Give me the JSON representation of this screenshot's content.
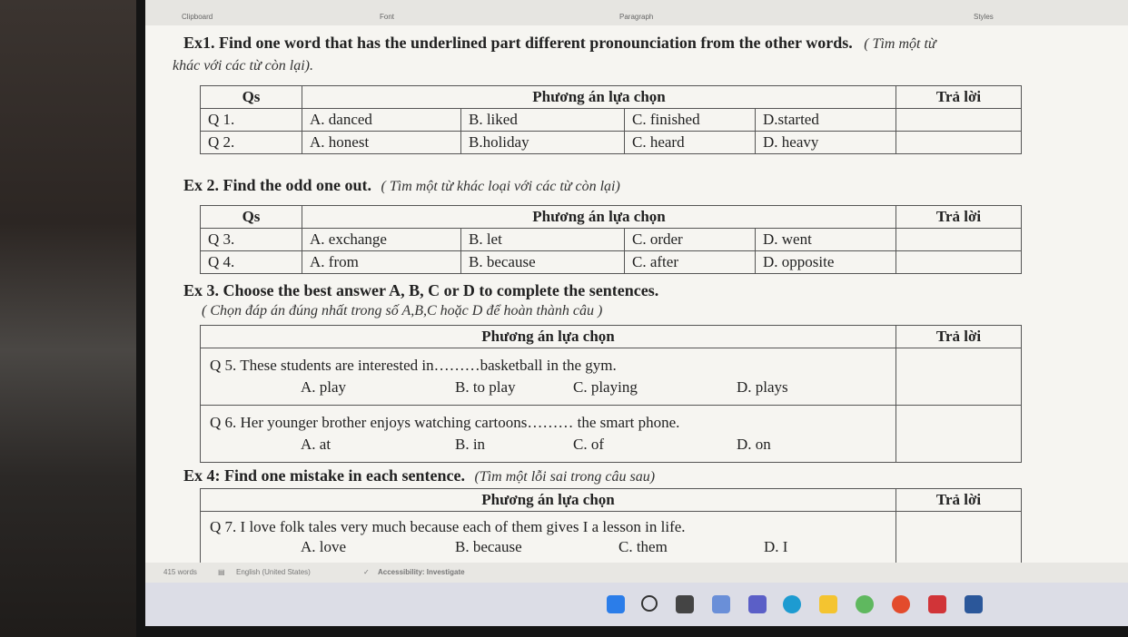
{
  "ribbon": {
    "clipboard": "Clipboard",
    "font": "Font",
    "paragraph": "Paragraph",
    "styles": "Styles"
  },
  "ex1": {
    "title": "Ex1. Find one word that has the underlined part different pronounciation from the other words.",
    "vi_a": "( Tìm một từ",
    "vi_b": "khác với các từ còn lại)."
  },
  "table1": {
    "h_qs": "Qs",
    "h_options": "Phương án lựa chọn",
    "h_answer": "Trả lời",
    "rows": [
      {
        "q": "Q 1.",
        "a": "A. danced",
        "b": "B. liked",
        "c": "C. finished",
        "d": "D.started"
      },
      {
        "q": "Q 2.",
        "a": "A. honest",
        "b": "B.holiday",
        "c": "C. heard",
        "d": "D. heavy"
      }
    ]
  },
  "ex2": {
    "title": "Ex 2. Find the odd one out.",
    "vi": "( Tìm một từ khác loại với các từ còn lại)"
  },
  "table2": {
    "h_qs": "Qs",
    "h_options": "Phương án lựa chọn",
    "h_answer": "Trả lời",
    "rows": [
      {
        "q": "Q 3.",
        "a": "A. exchange",
        "b": "B. let",
        "c": "C. order",
        "d": "D. went"
      },
      {
        "q": "Q 4.",
        "a": "A. from",
        "b": "B. because",
        "c": "C. after",
        "d": "D. opposite"
      }
    ]
  },
  "ex3": {
    "title": "Ex 3. Choose the best answer A, B, C or D to complete the sentences.",
    "vi": "( Chọn đáp án đúng nhất trong số A,B,C hoặc D để hoàn thành câu )"
  },
  "table3": {
    "h_options": "Phương án lựa chọn",
    "h_answer": "Trả lời",
    "q5": {
      "text": "Q 5. These students are interested in………basketball in the gym.",
      "a": "A. play",
      "b": "B. to play",
      "c": "C. playing",
      "d": "D. plays"
    },
    "q6": {
      "text": "Q 6. Her younger brother enjoys watching cartoons……… the smart phone.",
      "a": "A. at",
      "b": "B. in",
      "c": "C. of",
      "d": "D. on"
    }
  },
  "ex4": {
    "title": "Ex 4: Find one mistake in each sentence.",
    "vi": "(Tìm một lỗi sai trong câu sau)"
  },
  "table4": {
    "h_options": "Phương án lựa chọn",
    "h_answer": "Trả lời",
    "q7": {
      "text": "Q 7. I love folk tales very much because each of them gives I a lesson in life.",
      "a": "A. love",
      "b": "B. because",
      "c": "C. them",
      "d": "D. I"
    }
  },
  "status": {
    "words": "415 words",
    "language": "English (United States)",
    "accessibility": "Accessibility: Investigate"
  },
  "colors": {
    "accent": "#2b579a"
  }
}
